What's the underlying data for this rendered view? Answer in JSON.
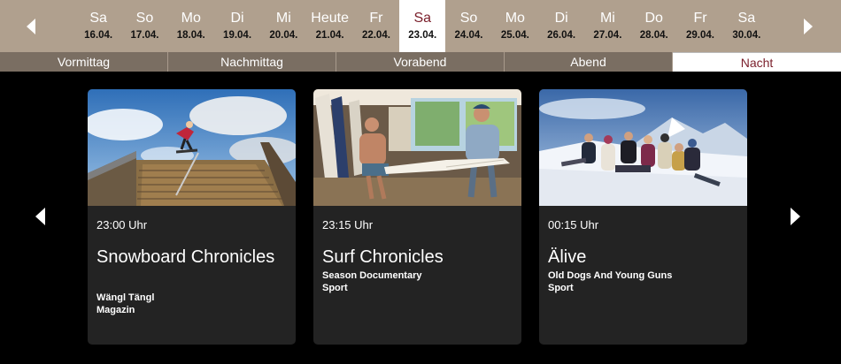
{
  "date_nav": {
    "days": [
      {
        "name": "Sa",
        "date": "16.04."
      },
      {
        "name": "So",
        "date": "17.04."
      },
      {
        "name": "Mo",
        "date": "18.04."
      },
      {
        "name": "Di",
        "date": "19.04."
      },
      {
        "name": "Mi",
        "date": "20.04."
      },
      {
        "name": "Heute",
        "date": "21.04."
      },
      {
        "name": "Fr",
        "date": "22.04."
      },
      {
        "name": "Sa",
        "date": "23.04.",
        "active": true
      },
      {
        "name": "So",
        "date": "24.04."
      },
      {
        "name": "Mo",
        "date": "25.04."
      },
      {
        "name": "Di",
        "date": "26.04."
      },
      {
        "name": "Mi",
        "date": "27.04."
      },
      {
        "name": "Do",
        "date": "28.04."
      },
      {
        "name": "Fr",
        "date": "29.04."
      },
      {
        "name": "Sa",
        "date": "30.04."
      }
    ],
    "prev_icon": "chevron-left-icon",
    "next_icon": "chevron-right-icon"
  },
  "time_slots": [
    {
      "label": "Vormittag"
    },
    {
      "label": "Nachmittag"
    },
    {
      "label": "Vorabend"
    },
    {
      "label": "Abend"
    },
    {
      "label": "Nacht",
      "active": true
    }
  ],
  "programs": [
    {
      "time": "23:00 Uhr",
      "title": "Snowboard Chronicles",
      "subtitle": "Wängl Tängl",
      "genre": "Magazin",
      "image": "snowboarder-on-stair-rail"
    },
    {
      "time": "23:15 Uhr",
      "title": "Surf Chronicles",
      "subtitle": "Season Documentary",
      "genre": "Sport",
      "image": "surfers-with-surfboard"
    },
    {
      "time": "00:15 Uhr",
      "title": "Älive",
      "subtitle": "Old Dogs And Young Guns",
      "genre": "Sport",
      "image": "group-in-snowy-mountains"
    }
  ],
  "colors": {
    "date_bar": "#b0a08e",
    "time_bar": "#7a6e62",
    "accent": "#7a1f2b",
    "card_bg": "#232323",
    "page_bg": "#000000"
  }
}
